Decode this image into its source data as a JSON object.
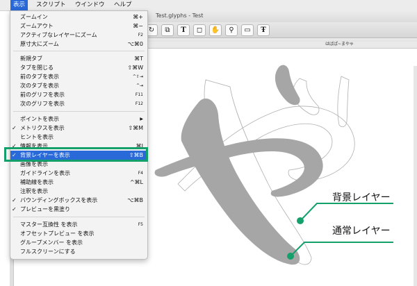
{
  "menubar": {
    "items": [
      "表示",
      "スクリプト",
      "ウインドウ",
      "ヘルプ"
    ],
    "active_index": 0
  },
  "window": {
    "title": "Test.glyphs - Test",
    "tab_label": "はばぱ~まやゃ"
  },
  "toolbar": {
    "tools": [
      "rotate-icon",
      "transform-icon",
      "text-tool-icon",
      "annotation-icon",
      "hand-icon",
      "zoom-icon",
      "measure-icon",
      "type-tool-icon"
    ]
  },
  "menu": {
    "items": [
      {
        "label": "ズームイン",
        "shortcut": "⌘+",
        "checked": false
      },
      {
        "label": "ズームアウト",
        "shortcut": "⌘−",
        "checked": false
      },
      {
        "label": "アクティブなレイヤーにズーム",
        "shortcut": "F2",
        "checked": false
      },
      {
        "label": "原寸大にズーム",
        "shortcut": "⌥⌘0",
        "checked": false
      },
      {
        "label": "新規タブ",
        "shortcut": "⌘T",
        "checked": false
      },
      {
        "label": "タブを閉じる",
        "shortcut": "⇧⌘W",
        "checked": false
      },
      {
        "label": "前のタブを表示",
        "shortcut": "^⇧⇥",
        "checked": false
      },
      {
        "label": "次のタブを表示",
        "shortcut": "^⇥",
        "checked": false
      },
      {
        "label": "前のグリフを表示",
        "shortcut": "F11",
        "checked": false
      },
      {
        "label": "次のグリフを表示",
        "shortcut": "F12",
        "checked": false
      },
      {
        "label": "ポイントを表示",
        "shortcut": "▶",
        "checked": false
      },
      {
        "label": "メトリクスを表示",
        "shortcut": "⇧⌘M",
        "checked": true
      },
      {
        "label": "ヒントを表示",
        "shortcut": "",
        "checked": false
      },
      {
        "label": "情報を表示",
        "shortcut": "⌘I",
        "checked": true
      },
      {
        "label": "背景レイヤーを表示",
        "shortcut": "⇧⌘B",
        "checked": true
      },
      {
        "label": "画像を表示",
        "shortcut": "",
        "checked": false
      },
      {
        "label": "ガイドラインを表示",
        "shortcut": "F4",
        "checked": false
      },
      {
        "label": "補助線を表示",
        "shortcut": "^⌘L",
        "checked": false
      },
      {
        "label": "注釈を表示",
        "shortcut": "",
        "checked": false
      },
      {
        "label": "バウンディングボックスを表示",
        "shortcut": "⌥⌘B",
        "checked": true
      },
      {
        "label": "プレビューを黒塗り",
        "shortcut": "",
        "checked": true
      },
      {
        "label": "マスター互換性 を表示",
        "shortcut": "F5",
        "checked": false
      },
      {
        "label": "オフセットプレビュー を表示",
        "shortcut": "",
        "checked": false
      },
      {
        "label": "グループメンバー を表示",
        "shortcut": "",
        "checked": false
      },
      {
        "label": "フルスクリーンにする",
        "shortcut": "",
        "checked": false
      }
    ]
  },
  "callouts": {
    "background_layer": "背景レイヤー",
    "normal_layer": "通常レイヤー"
  },
  "colors": {
    "menu_highlight": "#2a69d8",
    "callout_green": "#13a06a",
    "glyph_gray": "#a6a6a6"
  }
}
